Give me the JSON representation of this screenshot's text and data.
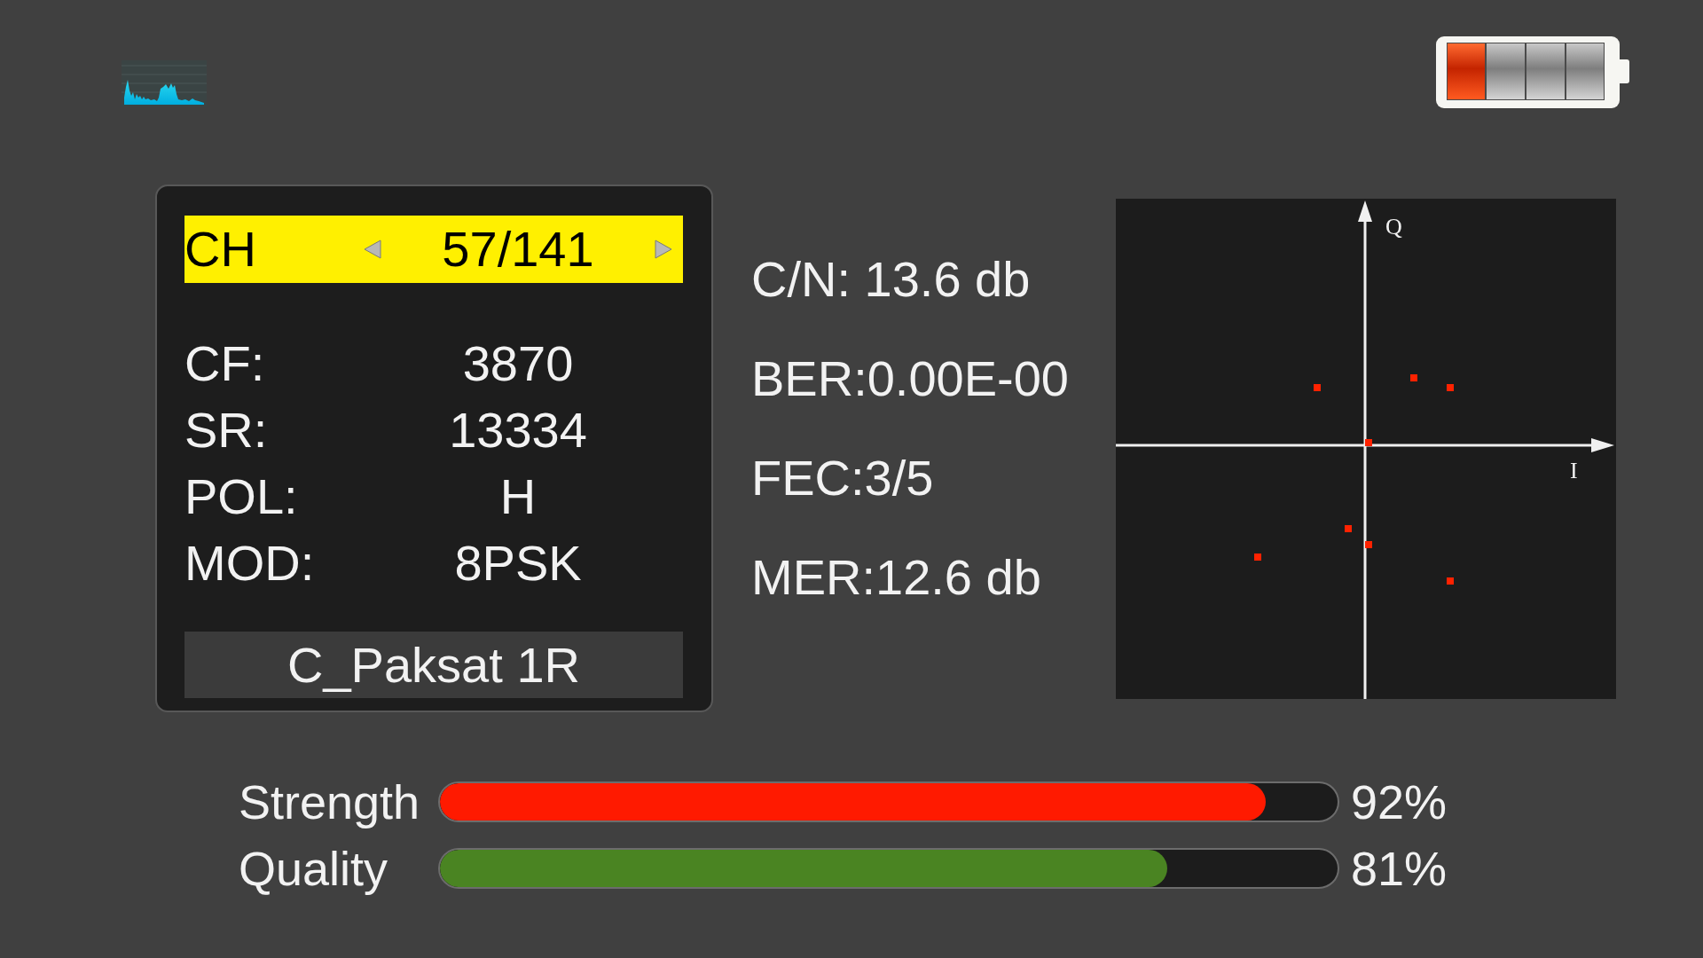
{
  "channel": {
    "label": "CH",
    "value": "57/141"
  },
  "params": [
    {
      "label": "CF:",
      "value": "3870"
    },
    {
      "label": "SR:",
      "value": "13334"
    },
    {
      "label": "POL:",
      "value": "H"
    },
    {
      "label": "MOD:",
      "value": "8PSK"
    }
  ],
  "satellite": "C_Paksat 1R",
  "metrics": [
    "C/N: 13.6 db",
    "BER:0.00E-00",
    "FEC:3/5",
    "MER:12.6 db"
  ],
  "constellation": {
    "y_axis_label": "Q",
    "x_axis_label": "I"
  },
  "meters": [
    {
      "label": "Strength",
      "level": 0.92,
      "reading": "92%",
      "color": "#ff1a00"
    },
    {
      "label": "Quality",
      "level": 0.81,
      "reading": "81%",
      "color": "#4a8422"
    }
  ]
}
